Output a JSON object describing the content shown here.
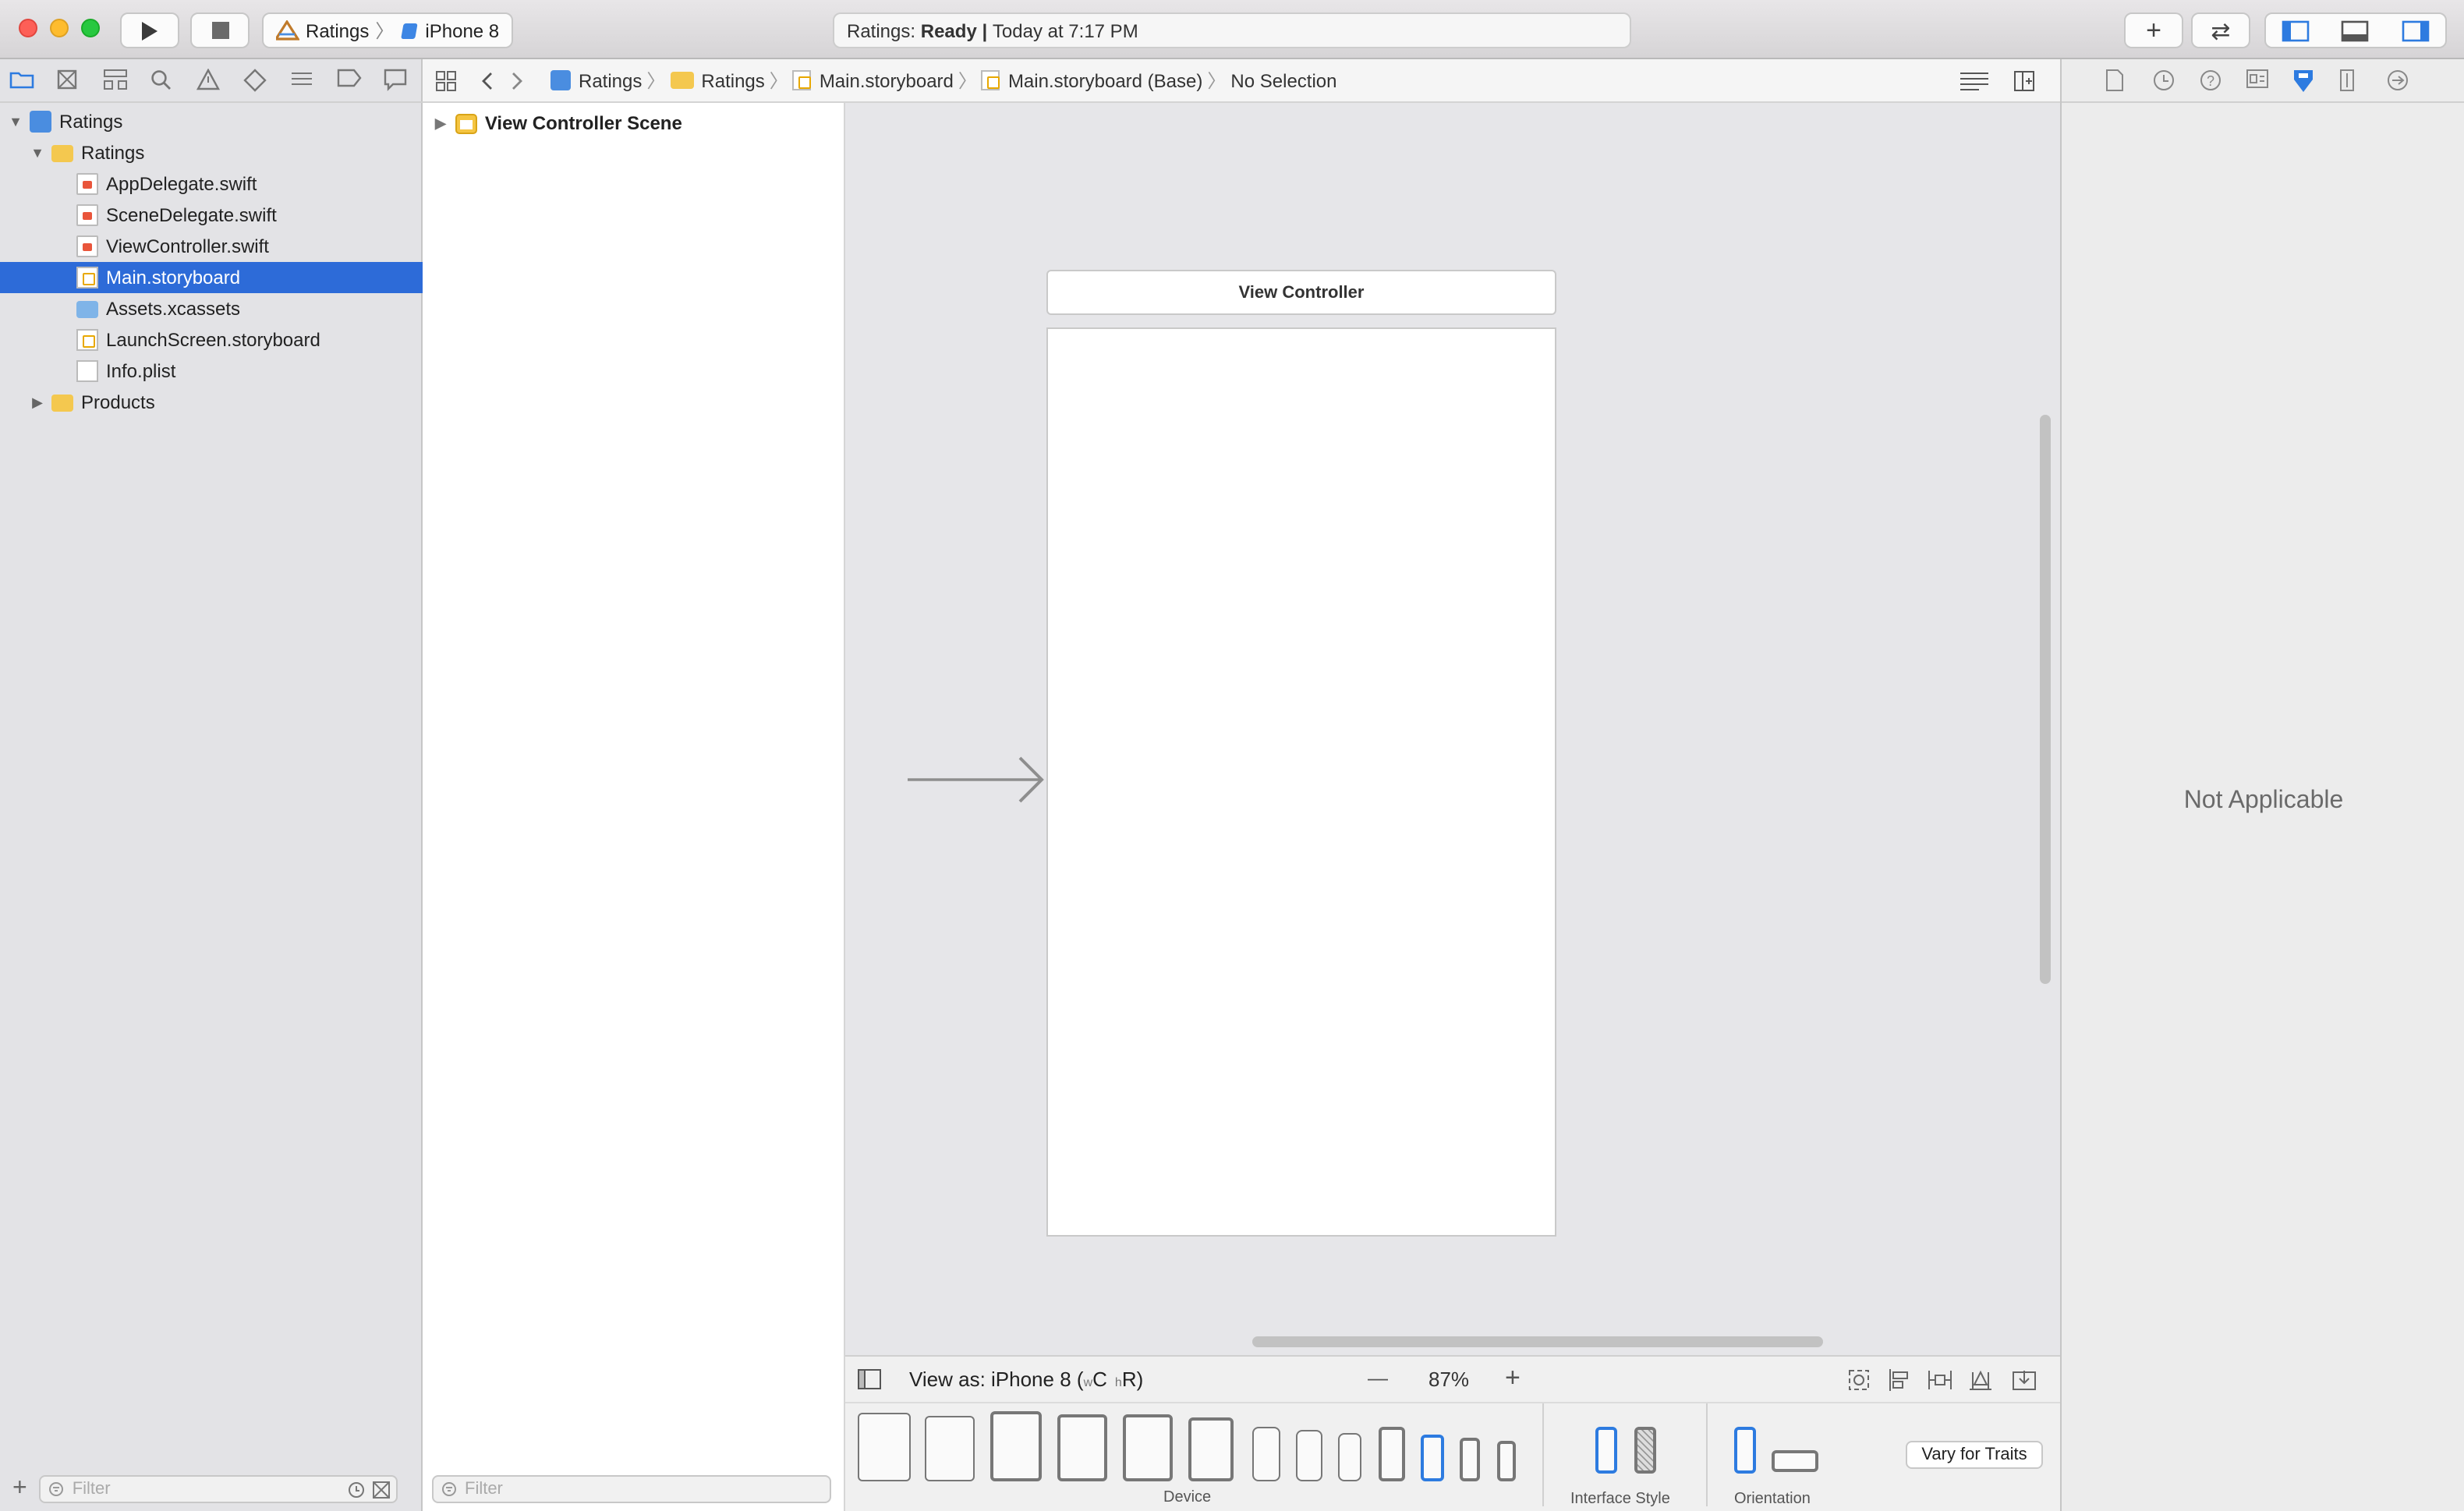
{
  "toolbar": {
    "scheme_project": "Ratings",
    "scheme_device": "iPhone 8",
    "status_project": "Ratings:",
    "status_state": "Ready",
    "status_sep": "|",
    "status_time": "Today at 7:17 PM",
    "add_icon": "+",
    "swap_icon": "⇄"
  },
  "navigator": {
    "items": [
      {
        "label": "Ratings"
      },
      {
        "label": "Ratings"
      },
      {
        "label": "AppDelegate.swift"
      },
      {
        "label": "SceneDelegate.swift"
      },
      {
        "label": "ViewController.swift"
      },
      {
        "label": "Main.storyboard"
      },
      {
        "label": "Assets.xcassets"
      },
      {
        "label": "LaunchScreen.storyboard"
      },
      {
        "label": "Info.plist"
      },
      {
        "label": "Products"
      }
    ],
    "filter_placeholder": "Filter",
    "add_icon": "+"
  },
  "jumpbar": {
    "crumbs": [
      "Ratings",
      "Ratings",
      "Main.storyboard",
      "Main.storyboard (Base)",
      "No Selection"
    ]
  },
  "outline": {
    "scene_label": "View Controller Scene",
    "filter_placeholder": "Filter"
  },
  "canvas": {
    "vc_title": "View Controller"
  },
  "bottom": {
    "view_as_prefix": "View as: iPhone 8 (",
    "w_small": "w",
    "w_big": "C",
    "h_small": "h",
    "h_big": "R",
    "view_as_suffix": ")",
    "zoom_out": "—",
    "zoom": "87%",
    "zoom_in": "+",
    "device_caption": "Device",
    "style_caption": "Interface Style",
    "orientation_caption": "Orientation",
    "vary_button": "Vary for Traits"
  },
  "inspector": {
    "message": "Not Applicable"
  },
  "colors": {
    "selection": "#2d6bd8",
    "accent": "#2d7be0"
  }
}
